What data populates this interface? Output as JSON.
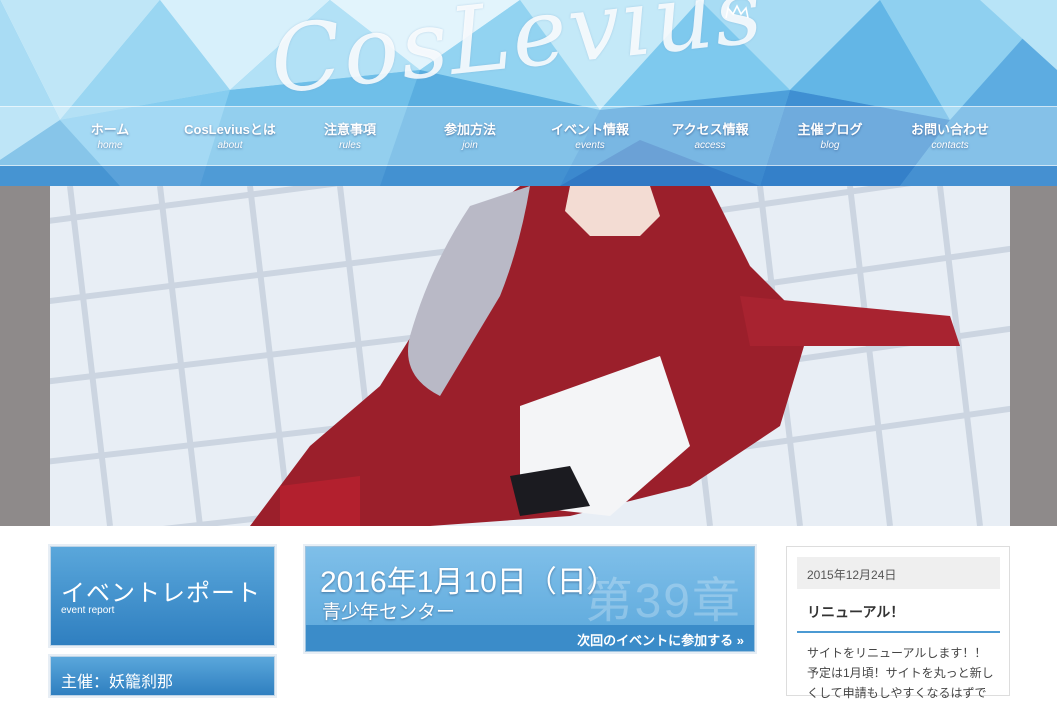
{
  "header": {
    "logo_text": "CosLevius",
    "nav": [
      {
        "label": "ホーム",
        "sub": "home"
      },
      {
        "label": "CosLeviusとは",
        "sub": "about"
      },
      {
        "label": "注意事項",
        "sub": "rules"
      },
      {
        "label": "参加方法",
        "sub": "join"
      },
      {
        "label": "イベント情報",
        "sub": "events"
      },
      {
        "label": "アクセス情報",
        "sub": "access"
      },
      {
        "label": "主催ブログ",
        "sub": "blog"
      },
      {
        "label": "お問い合わせ",
        "sub": "contacts"
      }
    ]
  },
  "left": {
    "report_title": "イベントレポート",
    "report_sub": "event report",
    "organizer": "主催：妖籠刹那"
  },
  "event": {
    "date": "2016年1月10日（日）",
    "venue": "青少年センター",
    "chapter": "第39章",
    "join_label": "次回のイベントに参加する »"
  },
  "side": {
    "date": "2015年12月24日",
    "title": "リニューアル！",
    "body": "サイトをリニューアルします！！予定は1月頃！サイトを丸っと新しくして申請もしやすくなるはずで"
  },
  "colors": {
    "accent": "#3b8cc9",
    "header_blue": "#6cc0ea"
  }
}
